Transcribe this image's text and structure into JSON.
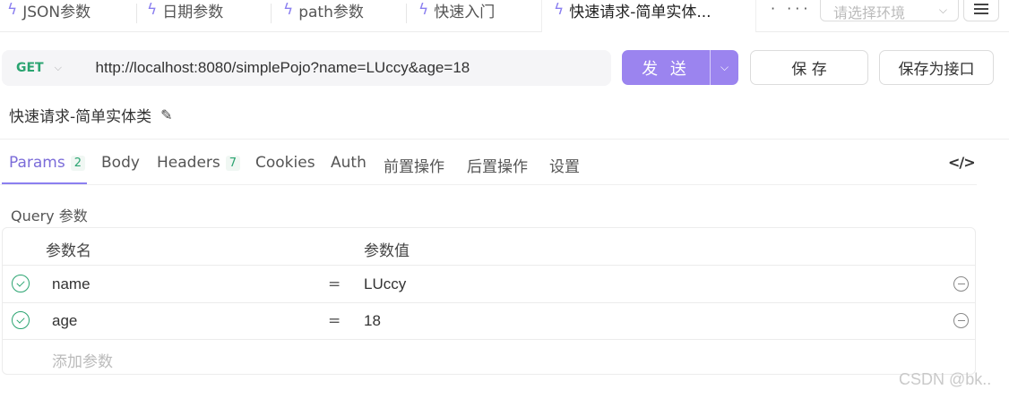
{
  "tabs": [
    {
      "label": "JSON参数"
    },
    {
      "label": "日期参数"
    },
    {
      "label": "path参数"
    },
    {
      "label": "快速入门"
    },
    {
      "label": "快速请求-简单实体..."
    }
  ],
  "tab_more": "· ···",
  "env_select": {
    "placeholder": "请选择环境"
  },
  "request": {
    "method": "GET",
    "url": "http://localhost:8080/simplePojo?name=LUccy&age=18",
    "send_label": "发 送",
    "save_label": "保 存",
    "save_as_label": "保存为接口",
    "title": "快速请求-简单实体类"
  },
  "param_tabs": [
    {
      "label": "Params",
      "badge": "2"
    },
    {
      "label": "Body"
    },
    {
      "label": "Headers",
      "badge": "7"
    },
    {
      "label": "Cookies"
    },
    {
      "label": "Auth"
    },
    {
      "label": "前置操作"
    },
    {
      "label": "后置操作"
    },
    {
      "label": "设置"
    }
  ],
  "query": {
    "title": "Query 参数",
    "col_name": "参数名",
    "col_value": "参数值",
    "rows": [
      {
        "name": "name",
        "eq": "=",
        "value": "LUccy"
      },
      {
        "name": "age",
        "eq": "=",
        "value": "18"
      }
    ],
    "add_placeholder": "添加参数"
  },
  "code_icon": "</>",
  "watermark": "CSDN @bk..",
  "colors": {
    "accent": "#8b7ff0",
    "send": "#9b84ef",
    "get": "#2ba471"
  }
}
